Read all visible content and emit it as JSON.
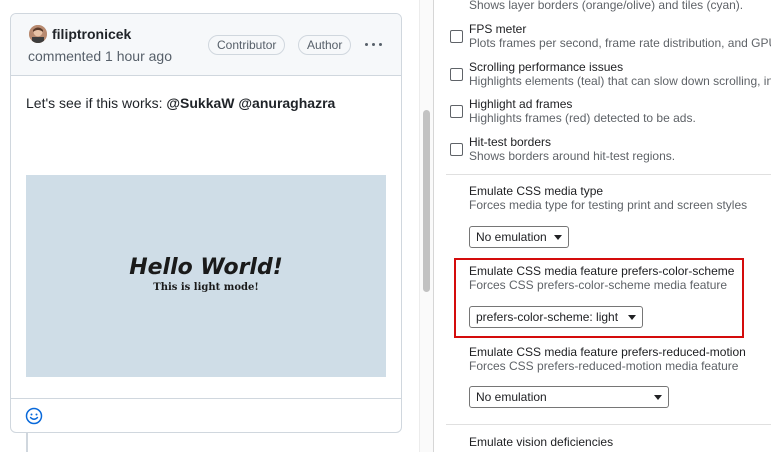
{
  "comment": {
    "author": "filiptronicek",
    "meta": "commented 1 hour ago",
    "badges": [
      "Contributor",
      "Author"
    ],
    "body_prefix": "Let's see if this works: ",
    "mention1": "@SukkaW",
    "mention2": "@anuraghazra",
    "image": {
      "headline": "Hello World!",
      "subline": "This is light mode!",
      "background": "#cfdde7"
    }
  },
  "devtools": {
    "checkboxes": [
      {
        "title": "",
        "desc": "Shows layer borders (orange/olive) and tiles (cyan).",
        "checked": false
      },
      {
        "title": "FPS meter",
        "desc": "Plots frames per second, frame rate distribution, and GPU",
        "checked": false
      },
      {
        "title": "Scrolling performance issues",
        "desc": "Highlights elements (teal) that can slow down scrolling, in",
        "checked": false
      },
      {
        "title": "Highlight ad frames",
        "desc": "Highlights frames (red) detected to be ads.",
        "checked": false
      },
      {
        "title": "Hit-test borders",
        "desc": "Shows borders around hit-test regions.",
        "checked": false
      }
    ],
    "media_type": {
      "title": "Emulate CSS media type",
      "desc": "Forces media type for testing print and screen styles",
      "value": "No emulation"
    },
    "color_scheme": {
      "title": "Emulate CSS media feature prefers-color-scheme",
      "desc": "Forces CSS prefers-color-scheme media feature",
      "value": "prefers-color-scheme: light"
    },
    "reduced_motion": {
      "title": "Emulate CSS media feature prefers-reduced-motion",
      "desc": "Forces CSS prefers-reduced-motion media feature",
      "value": "No emulation"
    },
    "vision": {
      "title": "Emulate vision deficiencies"
    },
    "highlight_color": "#d40c0c"
  }
}
